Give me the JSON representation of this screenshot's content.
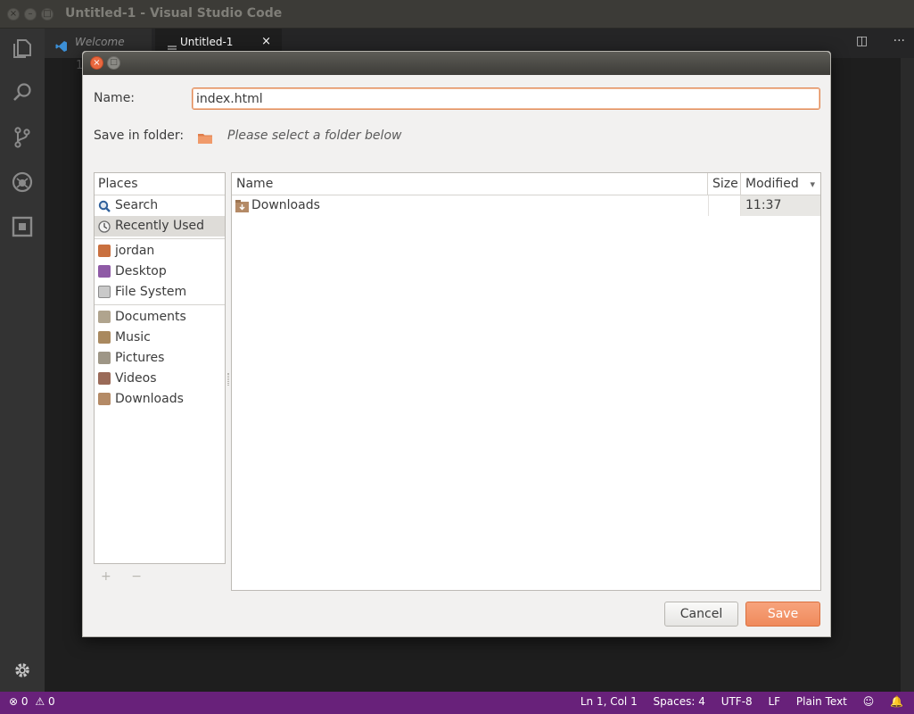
{
  "window": {
    "title": "Untitled-1 - Visual Studio Code",
    "close_glyph": "×",
    "minimize_glyph": "–",
    "maximize_glyph": "□"
  },
  "tabs": [
    {
      "label": "Welcome",
      "icon": "vscode-logo-icon",
      "active": false
    },
    {
      "label": "Untitled-1",
      "icon": "file-lines-icon",
      "active": true,
      "close_glyph": "×"
    }
  ],
  "editor": {
    "line_number": "1",
    "actions": {
      "split_glyph": "◫",
      "more_glyph": "···"
    }
  },
  "activity_bar": {
    "items": [
      "explorer-icon",
      "search-icon",
      "source-control-icon",
      "debug-icon",
      "extensions-icon"
    ],
    "bottom": "gear-icon"
  },
  "dialog": {
    "close_glyph": "×",
    "max_glyph": "□",
    "name_label": "Name:",
    "name_value": "index.html",
    "folder_label": "Save in folder:",
    "folder_hint": "Please select a folder below",
    "places_header": "Places",
    "places_group1": [
      {
        "label": "Search",
        "icon": "search-icon"
      },
      {
        "label": "Recently Used",
        "icon": "clock-icon",
        "selected": true
      }
    ],
    "places_group2": [
      {
        "label": "jordan",
        "icon": "home-folder-icon"
      },
      {
        "label": "Desktop",
        "icon": "desktop-icon"
      },
      {
        "label": "File System",
        "icon": "drive-icon"
      }
    ],
    "places_group3": [
      {
        "label": "Documents",
        "icon": "documents-folder-icon"
      },
      {
        "label": "Music",
        "icon": "music-folder-icon"
      },
      {
        "label": "Pictures",
        "icon": "pictures-folder-icon"
      },
      {
        "label": "Videos",
        "icon": "videos-folder-icon"
      },
      {
        "label": "Downloads",
        "icon": "downloads-folder-icon"
      }
    ],
    "add_glyph": "+",
    "remove_glyph": "−",
    "columns": {
      "name": "Name",
      "size": "Size",
      "modified": "Modified",
      "sort_glyph": "▾"
    },
    "files": [
      {
        "name": "Downloads",
        "size": "",
        "modified": "11:37",
        "icon": "downloads-folder-icon"
      }
    ],
    "cancel_label": "Cancel",
    "save_label": "Save"
  },
  "status": {
    "errors": "0",
    "warnings": "0",
    "position": "Ln 1, Col 1",
    "spaces": "Spaces: 4",
    "encoding": "UTF-8",
    "eol": "LF",
    "language": "Plain Text"
  },
  "colors": {
    "status_bar": "#68217a",
    "accent": "#ef8a5c",
    "vscode_blue": "#3c8fd6"
  }
}
